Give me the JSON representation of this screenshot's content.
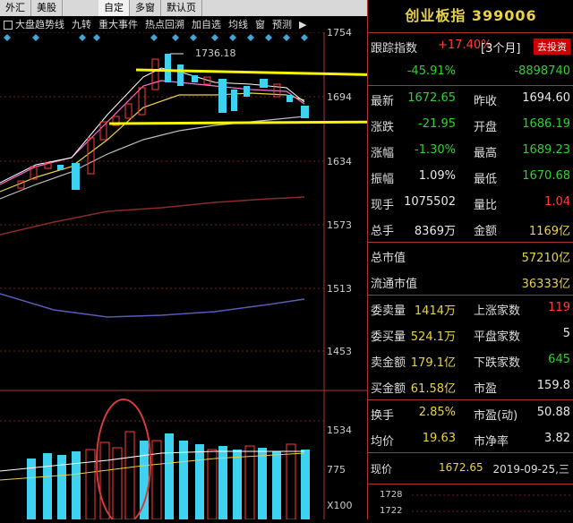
{
  "tabs": [
    {
      "label": "外汇"
    },
    {
      "label": "美股"
    },
    {
      "label": "自定"
    },
    {
      "label": "多窗"
    },
    {
      "label": "默认页"
    }
  ],
  "toolbar": {
    "items": [
      "大盘趋势线",
      "九转",
      "重大事件",
      "热点回溯",
      "加自选",
      "均线",
      "窗",
      "预测"
    ],
    "arrow": "▶"
  },
  "chart": {
    "high_label": "1736.18",
    "y_ticks": [
      "1754",
      "1694",
      "1634",
      "1573",
      "1513",
      "1453"
    ],
    "vol_ticks": [
      "1534",
      "775"
    ],
    "vol_scale": "X100"
  },
  "panel": {
    "title": "创业板指 399006",
    "track_label": "跟踪指数",
    "track_value": "+17.40%",
    "track_period": "[3个月]",
    "track_button": "去投资",
    "row_hidden_value": "-45.91%",
    "row_hidden_value2": "-8898740",
    "rows": [
      {
        "l1": "最新",
        "v1": "1672.65",
        "l2": "昨收",
        "v2": "1694.60"
      },
      {
        "l1": "涨跌",
        "v1": "-21.95",
        "l2": "开盘",
        "v2": "1686.19"
      },
      {
        "l1": "涨幅",
        "v1": "-1.30%",
        "l2": "最高",
        "v2": "1689.23"
      },
      {
        "l1": "振幅",
        "v1": "1.09%",
        "l2": "最低",
        "v2": "1670.68"
      },
      {
        "l1": "现手",
        "v1": "1075502",
        "l2": "量比",
        "v2": "1.04"
      },
      {
        "l1": "总手",
        "v1": "8369万",
        "l2": "金额",
        "v2": "1169亿"
      }
    ],
    "caps": [
      {
        "l": "总市值",
        "v": "57210亿"
      },
      {
        "l": "流通市值",
        "v": "36333亿"
      }
    ],
    "stats": [
      {
        "l1": "委卖量",
        "v1": "1414万",
        "l2": "上涨家数",
        "v2": "119"
      },
      {
        "l1": "委买量",
        "v1": "524.1万",
        "l2": "平盘家数",
        "v2": "5"
      },
      {
        "l1": "卖金额",
        "v1": "179.1亿",
        "l2": "下跌家数",
        "v2": "645"
      },
      {
        "l1": "买金额",
        "v1": "61.58亿",
        "l2": "市盈",
        "v2": "159.8"
      },
      {
        "l1": "换手",
        "v1": "2.85%",
        "l2": "市盈(动)",
        "v2": "50.88"
      },
      {
        "l1": "均价",
        "v1": "19.63",
        "l2": "市净率",
        "v2": "3.82"
      }
    ],
    "price_label": "现价",
    "price_value": "1672.65",
    "price_date": "2019-09-25,三",
    "mini_labels": [
      "1728",
      "1722"
    ]
  }
}
